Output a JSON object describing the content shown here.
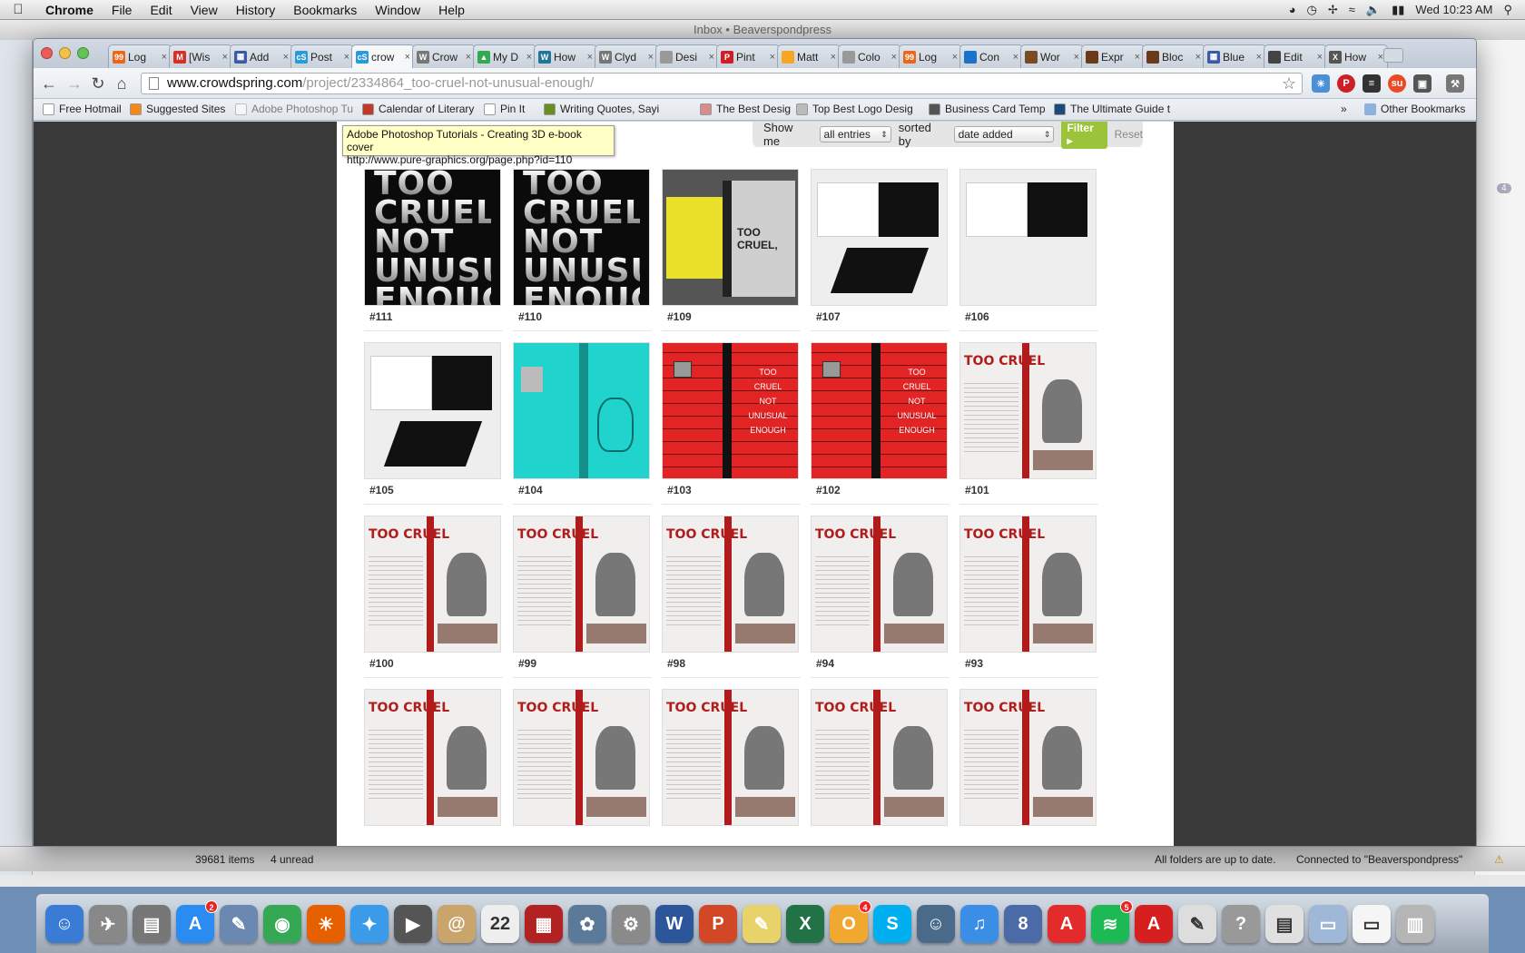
{
  "menubar": {
    "app": "Chrome",
    "items": [
      "File",
      "Edit",
      "View",
      "History",
      "Bookmarks",
      "Window",
      "Help"
    ],
    "clock": "Wed 10:23 AM"
  },
  "mail": {
    "title": "Inbox • Beaverspondpress",
    "items_count": "39681 items",
    "unread": "4 unread",
    "sync_status": "All folders are up to date.",
    "connection": "Connected to \"Beaverspondpress\"",
    "sidebar_badge": "4"
  },
  "tabs": [
    {
      "label": "Log",
      "color": "#e8671b",
      "glyph": "99"
    },
    {
      "label": "[Wis",
      "color": "#d93025",
      "glyph": "M"
    },
    {
      "label": "Add",
      "color": "#3b5ba5",
      "glyph": "▦"
    },
    {
      "label": "Post",
      "color": "#2a9bd8",
      "glyph": "cS"
    },
    {
      "label": "crow",
      "color": "#2a9bd8",
      "glyph": "cS",
      "active": true
    },
    {
      "label": "Crow",
      "color": "#777777",
      "glyph": "W"
    },
    {
      "label": "My D",
      "color": "#34a853",
      "glyph": "▲"
    },
    {
      "label": "How",
      "color": "#21759b",
      "glyph": "W"
    },
    {
      "label": "Clyd",
      "color": "#777777",
      "glyph": "W"
    },
    {
      "label": "Desi",
      "color": "#999999",
      "glyph": ""
    },
    {
      "label": "Pint",
      "color": "#cb2027",
      "glyph": "P"
    },
    {
      "label": "Matt",
      "color": "#f5a623",
      "glyph": ""
    },
    {
      "label": "Colo",
      "color": "#999999",
      "glyph": ""
    },
    {
      "label": "Log",
      "color": "#e8671b",
      "glyph": "99"
    },
    {
      "label": "Con",
      "color": "#1a73c9",
      "glyph": ""
    },
    {
      "label": "Wor",
      "color": "#7a4a22",
      "glyph": ""
    },
    {
      "label": "Expr",
      "color": "#6b3a1a",
      "glyph": ""
    },
    {
      "label": "Bloc",
      "color": "#6b3a1a",
      "glyph": ""
    },
    {
      "label": "Blue",
      "color": "#3b5ba5",
      "glyph": "▦"
    },
    {
      "label": "Edit",
      "color": "#444444",
      "glyph": ""
    },
    {
      "label": "How",
      "color": "#555555",
      "glyph": "X"
    }
  ],
  "address": {
    "host": "www.crowdspring.com",
    "path": "/project/2334864_too-cruel-not-unusual-enough/"
  },
  "bookmarks": [
    {
      "label": "Free Hotmail",
      "color": "#ffffff"
    },
    {
      "label": "Suggested Sites",
      "color": "#f28a1b"
    },
    {
      "label": "Adobe Photoshop Tu",
      "color": "#ffffff",
      "ghost": true
    },
    {
      "label": "Calendar of Literary",
      "color": "#c0392b"
    },
    {
      "label": "Pin It",
      "color": "#ffffff"
    },
    {
      "label": "Writing Quotes, Sayi",
      "color": "#6b8e23"
    },
    {
      "label": "The Best Designs /",
      "color": "#d98c8c"
    },
    {
      "label": "Top Best Logo Desig",
      "color": "#bbbbbb"
    },
    {
      "label": "Business Card Temp",
      "color": "#555555"
    },
    {
      "label": "The Ultimate Guide t",
      "color": "#1a4b7a"
    }
  ],
  "other_bookmarks": "Other Bookmarks",
  "tooltip": {
    "title": "Adobe Photoshop Tutorials - Creating 3D e-book cover",
    "url": "http://www.pure-graphics.org/page.php?id=110"
  },
  "filter": {
    "show_label": "Show me",
    "show_value": "all entries",
    "sort_label": "sorted by",
    "sort_value": "date added",
    "filter_btn": "Filter",
    "reset": "Reset"
  },
  "entries": [
    {
      "label": "#111",
      "art": "black",
      "text": "TOO CRUEL NOT UNUSUAL ENOUGH"
    },
    {
      "label": "#110",
      "art": "black",
      "text": "TOO CRUEL NOT UNUSUAL ENOUGH"
    },
    {
      "label": "#109",
      "art": "gray",
      "text": "TOO CRUEL,"
    },
    {
      "label": "#107",
      "art": "white"
    },
    {
      "label": "#106",
      "art": "white"
    },
    {
      "label": "#105",
      "art": "white"
    },
    {
      "label": "#104",
      "art": "teal"
    },
    {
      "label": "#103",
      "art": "red",
      "text": "TOO CRUEL NOT UNUSUAL ENOUGH"
    },
    {
      "label": "#102",
      "art": "red",
      "text": "TOO CRUEL NOT UNUSUAL ENOUGH"
    },
    {
      "label": "#101",
      "art": "cover",
      "text": "TOO CRUEL"
    },
    {
      "label": "#100",
      "art": "cover",
      "text": "TOO CRUEL"
    },
    {
      "label": "#99",
      "art": "cover",
      "text": "TOO CRUEL"
    },
    {
      "label": "#98",
      "art": "cover",
      "text": "TOO CRUEL"
    },
    {
      "label": "#94",
      "art": "cover",
      "text": "TOO CRUEL"
    },
    {
      "label": "#93",
      "art": "cover",
      "text": "TOO CRUEL"
    },
    {
      "label": "",
      "art": "cover",
      "text": "TOO CRUEL"
    },
    {
      "label": "",
      "art": "cover",
      "text": "TOO CRUEL"
    },
    {
      "label": "",
      "art": "cover",
      "text": "TOO CRUEL"
    },
    {
      "label": "",
      "art": "cover",
      "text": "TOO CRUEL"
    },
    {
      "label": "",
      "art": "cover",
      "text": "TOO CRUEL"
    }
  ],
  "dock": [
    {
      "name": "finder-icon",
      "color": "#3a7bd5",
      "glyph": "☺"
    },
    {
      "name": "launchpad-icon",
      "color": "#888888",
      "glyph": "✈"
    },
    {
      "name": "image-capture-icon",
      "color": "#777777",
      "glyph": "▤"
    },
    {
      "name": "app-store-icon",
      "color": "#2a8bf0",
      "glyph": "A",
      "badge": "2"
    },
    {
      "name": "preview-icon",
      "color": "#6a88b0",
      "glyph": "✎"
    },
    {
      "name": "chrome-icon",
      "color": "#34a853",
      "glyph": "◉"
    },
    {
      "name": "firefox-icon",
      "color": "#e66000",
      "glyph": "☀"
    },
    {
      "name": "safari-icon",
      "color": "#3c9be8",
      "glyph": "✦"
    },
    {
      "name": "facetime-icon",
      "color": "#555555",
      "glyph": "▶"
    },
    {
      "name": "address-book-icon",
      "color": "#c9a46b",
      "glyph": "@"
    },
    {
      "name": "calendar-icon",
      "color": "#eeeeee",
      "glyph": "22"
    },
    {
      "name": "photo-booth-icon",
      "color": "#b22222",
      "glyph": "▦"
    },
    {
      "name": "iphoto-icon",
      "color": "#5b7a99",
      "glyph": "✿"
    },
    {
      "name": "system-preferences-icon",
      "color": "#8a8a8a",
      "glyph": "⚙"
    },
    {
      "name": "word-icon",
      "color": "#2b579a",
      "glyph": "W"
    },
    {
      "name": "powerpoint-icon",
      "color": "#d24726",
      "glyph": "P"
    },
    {
      "name": "stickies-icon",
      "color": "#e8d36a",
      "glyph": "✎"
    },
    {
      "name": "excel-icon",
      "color": "#217346",
      "glyph": "X"
    },
    {
      "name": "outlook-icon",
      "color": "#f0a830",
      "glyph": "O",
      "badge": "4"
    },
    {
      "name": "skype-icon",
      "color": "#00aff0",
      "glyph": "S"
    },
    {
      "name": "iphoto-alt-icon",
      "color": "#4a6a8a",
      "glyph": "☺"
    },
    {
      "name": "itunes-icon",
      "color": "#3a8ee6",
      "glyph": "♫"
    },
    {
      "name": "ical-8-icon",
      "color": "#4a6aa8",
      "glyph": "8"
    },
    {
      "name": "acrobat-icon",
      "color": "#e32b2b",
      "glyph": "A"
    },
    {
      "name": "spotify-icon",
      "color": "#1db954",
      "glyph": "≋",
      "badge": "5"
    },
    {
      "name": "pdf-reader-icon",
      "color": "#d62020",
      "glyph": "A"
    },
    {
      "name": "textedit-icon",
      "color": "#dddddd",
      "glyph": "✎"
    },
    {
      "name": "help-icon",
      "color": "#999999",
      "glyph": "?"
    },
    {
      "name": "docx-stack-icon",
      "color": "#e0e0e0",
      "glyph": "▤"
    },
    {
      "name": "folder-stack-icon",
      "color": "#9fb8d8",
      "glyph": "▭"
    },
    {
      "name": "document-stack-icon",
      "color": "#f5f5f5",
      "glyph": "▭"
    },
    {
      "name": "trash-icon",
      "color": "#b5b5b5",
      "glyph": "▥"
    }
  ]
}
